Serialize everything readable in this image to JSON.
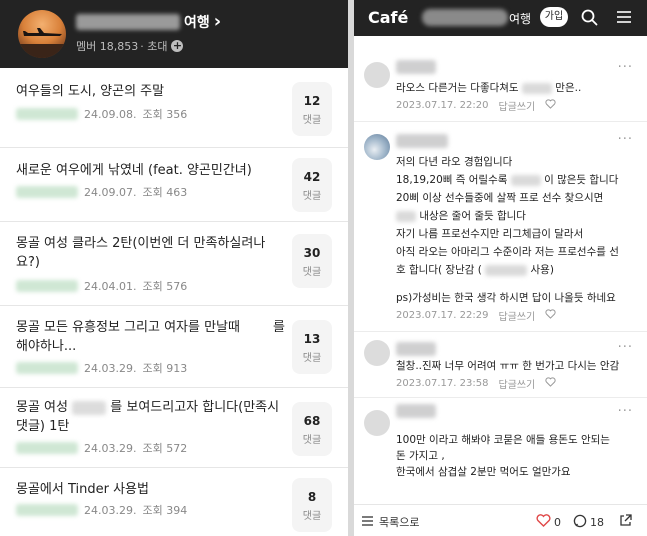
{
  "left": {
    "header": {
      "cafe_title": "여행",
      "title_chevron": "›",
      "members": "멤버 18,853",
      "invite": "· 초대"
    },
    "posts": [
      {
        "title": "여우들의 도시, 양곤의 주말",
        "date": "24.09.08.",
        "views": "조회 356",
        "comments": "12",
        "comment_label": "댓글"
      },
      {
        "title": "새로운 여우에게 낚였네 (feat. 양곤민간녀)",
        "date": "24.09.07.",
        "views": "조회 463",
        "comments": "42",
        "comment_label": "댓글"
      },
      {
        "title": "몽골 여성 클라스 2탄(이번엔 더 만족하실려나",
        "title2": "요?)",
        "date": "24.04.01.",
        "views": "조회 576",
        "comments": "30",
        "comment_label": "댓글"
      },
      {
        "title": "몽골 모든 유흥정보 그리고 여자를 만날때        를",
        "title2": "해야하나...",
        "date": "24.03.29.",
        "views": "조회 913",
        "comments": "13",
        "comment_label": "댓글"
      },
      {
        "title": "몽골 여성",
        "title_b": "를 보여드리고자 합니다(만족시",
        "title2": "댓글) 1탄",
        "date": "24.03.29.",
        "views": "조회 572",
        "comments": "68",
        "comment_label": "댓글"
      },
      {
        "title": "몽골에서 Tinder 사용법",
        "date": "24.03.29.",
        "views": "조회 394",
        "comments": "8",
        "comment_label": "댓글"
      }
    ]
  },
  "right": {
    "header": {
      "logo": "Café",
      "cafe_name": "여행",
      "join_label": "가입"
    },
    "comments": [
      {
        "lines": [
          "라오스 다른거는 다좋다쳐도",
          "만은.."
        ],
        "date": "2023.07.17. 22:20",
        "reply": "답글쓰기"
      },
      {
        "lines": [
          "저의 다년 라오 경험입니다",
          "18,19,20삐 즉 어릴수록",
          "이 많은듯 합니다",
          "20삐 이상 선수들중에 살짝 프로 선수 찾으시면",
          "내상은 줄어 줄듯 합니다",
          "자기 나름 프로선수지만 리그체급이 달라서",
          "아직 라오는 아마리그 수준이라 저는 프로선수를 선",
          "호 합니다( 장난감 (",
          "사용)",
          "ps)가성비는 한국 생각 하시면 답이 나올듯 하네요"
        ],
        "date": "2023.07.17. 22:29",
        "reply": "답글쓰기"
      },
      {
        "lines": [
          "철창..진짜 너무 어려여 ㅠㅠ 한 번가고 다시는 안감"
        ],
        "date": "2023.07.17. 23:58",
        "reply": "답글쓰기"
      },
      {
        "lines": [
          "100만 이라고 해봐야 코묻은 애들 용돈도 안되는",
          "돈 가지고 ,",
          "한국에서 삼겹살 2분만 먹어도 얼만가요"
        ],
        "date": "",
        "reply": ""
      }
    ],
    "bottom": {
      "list_label": "목록으로",
      "likes": "0",
      "comments": "18"
    }
  },
  "icons": {
    "more": "more-dots-icon",
    "heart": "heart-icon",
    "comment": "comment-icon",
    "share": "share-icon",
    "list": "list-icon",
    "search": "search-icon",
    "menu": "hamburger-menu-icon"
  }
}
